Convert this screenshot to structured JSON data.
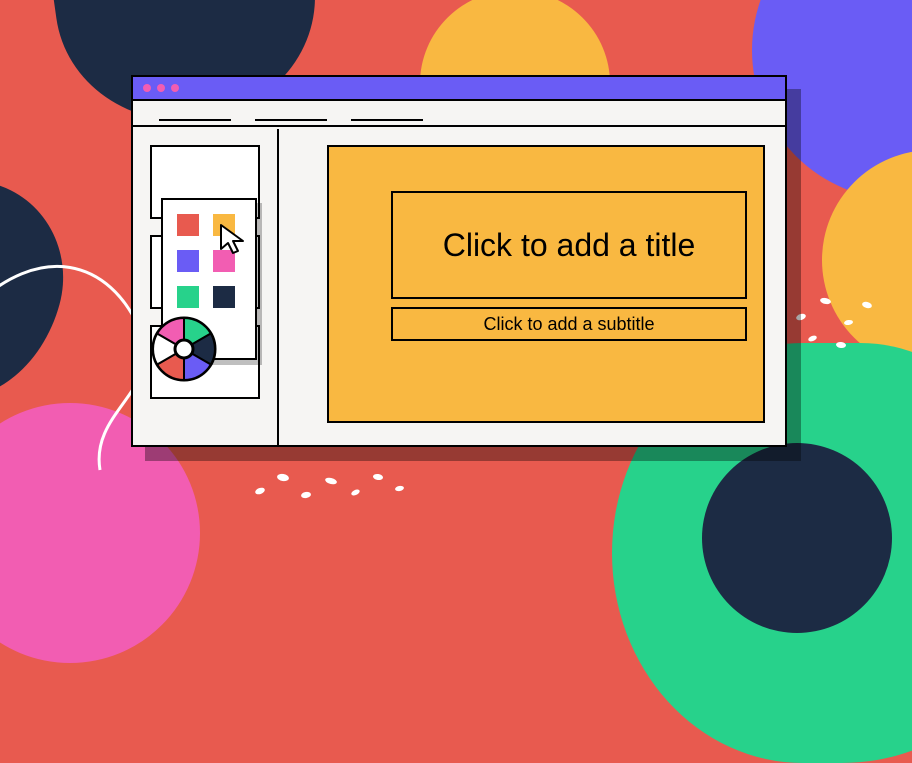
{
  "slide": {
    "title_placeholder": "Click to add a title",
    "subtitle_placeholder": "Click to add a subtitle",
    "background_color": "#f9b841"
  },
  "thumbnails": {
    "count": 3
  },
  "color_picker": {
    "swatches": [
      "#e85a4f",
      "#f9b841",
      "#6a5cf5",
      "#f25db2",
      "#27d28b",
      "#1c2b44"
    ],
    "selected_index": 1
  },
  "window": {
    "traffic_light_color": "#f25db2",
    "menu_items": 3
  }
}
